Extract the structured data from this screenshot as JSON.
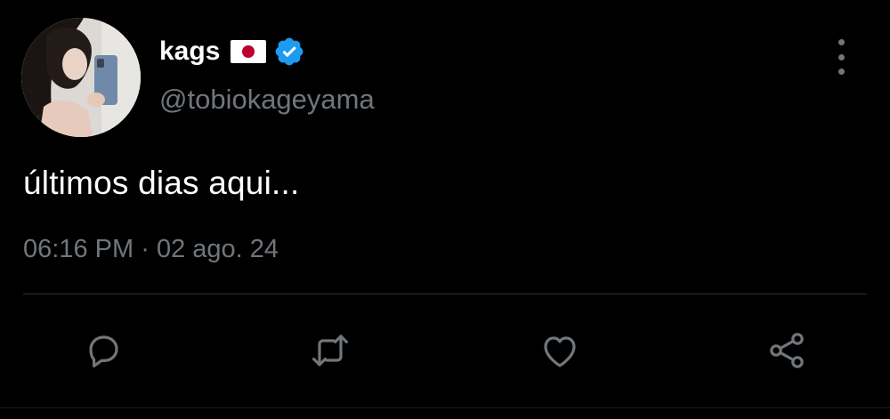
{
  "author": {
    "display_name": "kags",
    "handle": "@tobiokageyama",
    "flag_icon": "japan-flag-icon",
    "verified_icon": "verified-badge-icon"
  },
  "tweet": {
    "text": "últimos dias aqui...",
    "time": "06:16 PM",
    "separator": "·",
    "date": "02 ago. 24"
  },
  "actions": {
    "reply_icon": "reply-icon",
    "retweet_icon": "retweet-icon",
    "like_icon": "heart-icon",
    "share_icon": "share-icon"
  },
  "colors": {
    "background": "#000000",
    "primary_text": "#ffffff",
    "secondary_text": "#71767b",
    "verified": "#1d9bf0",
    "divider": "#2f3336"
  }
}
